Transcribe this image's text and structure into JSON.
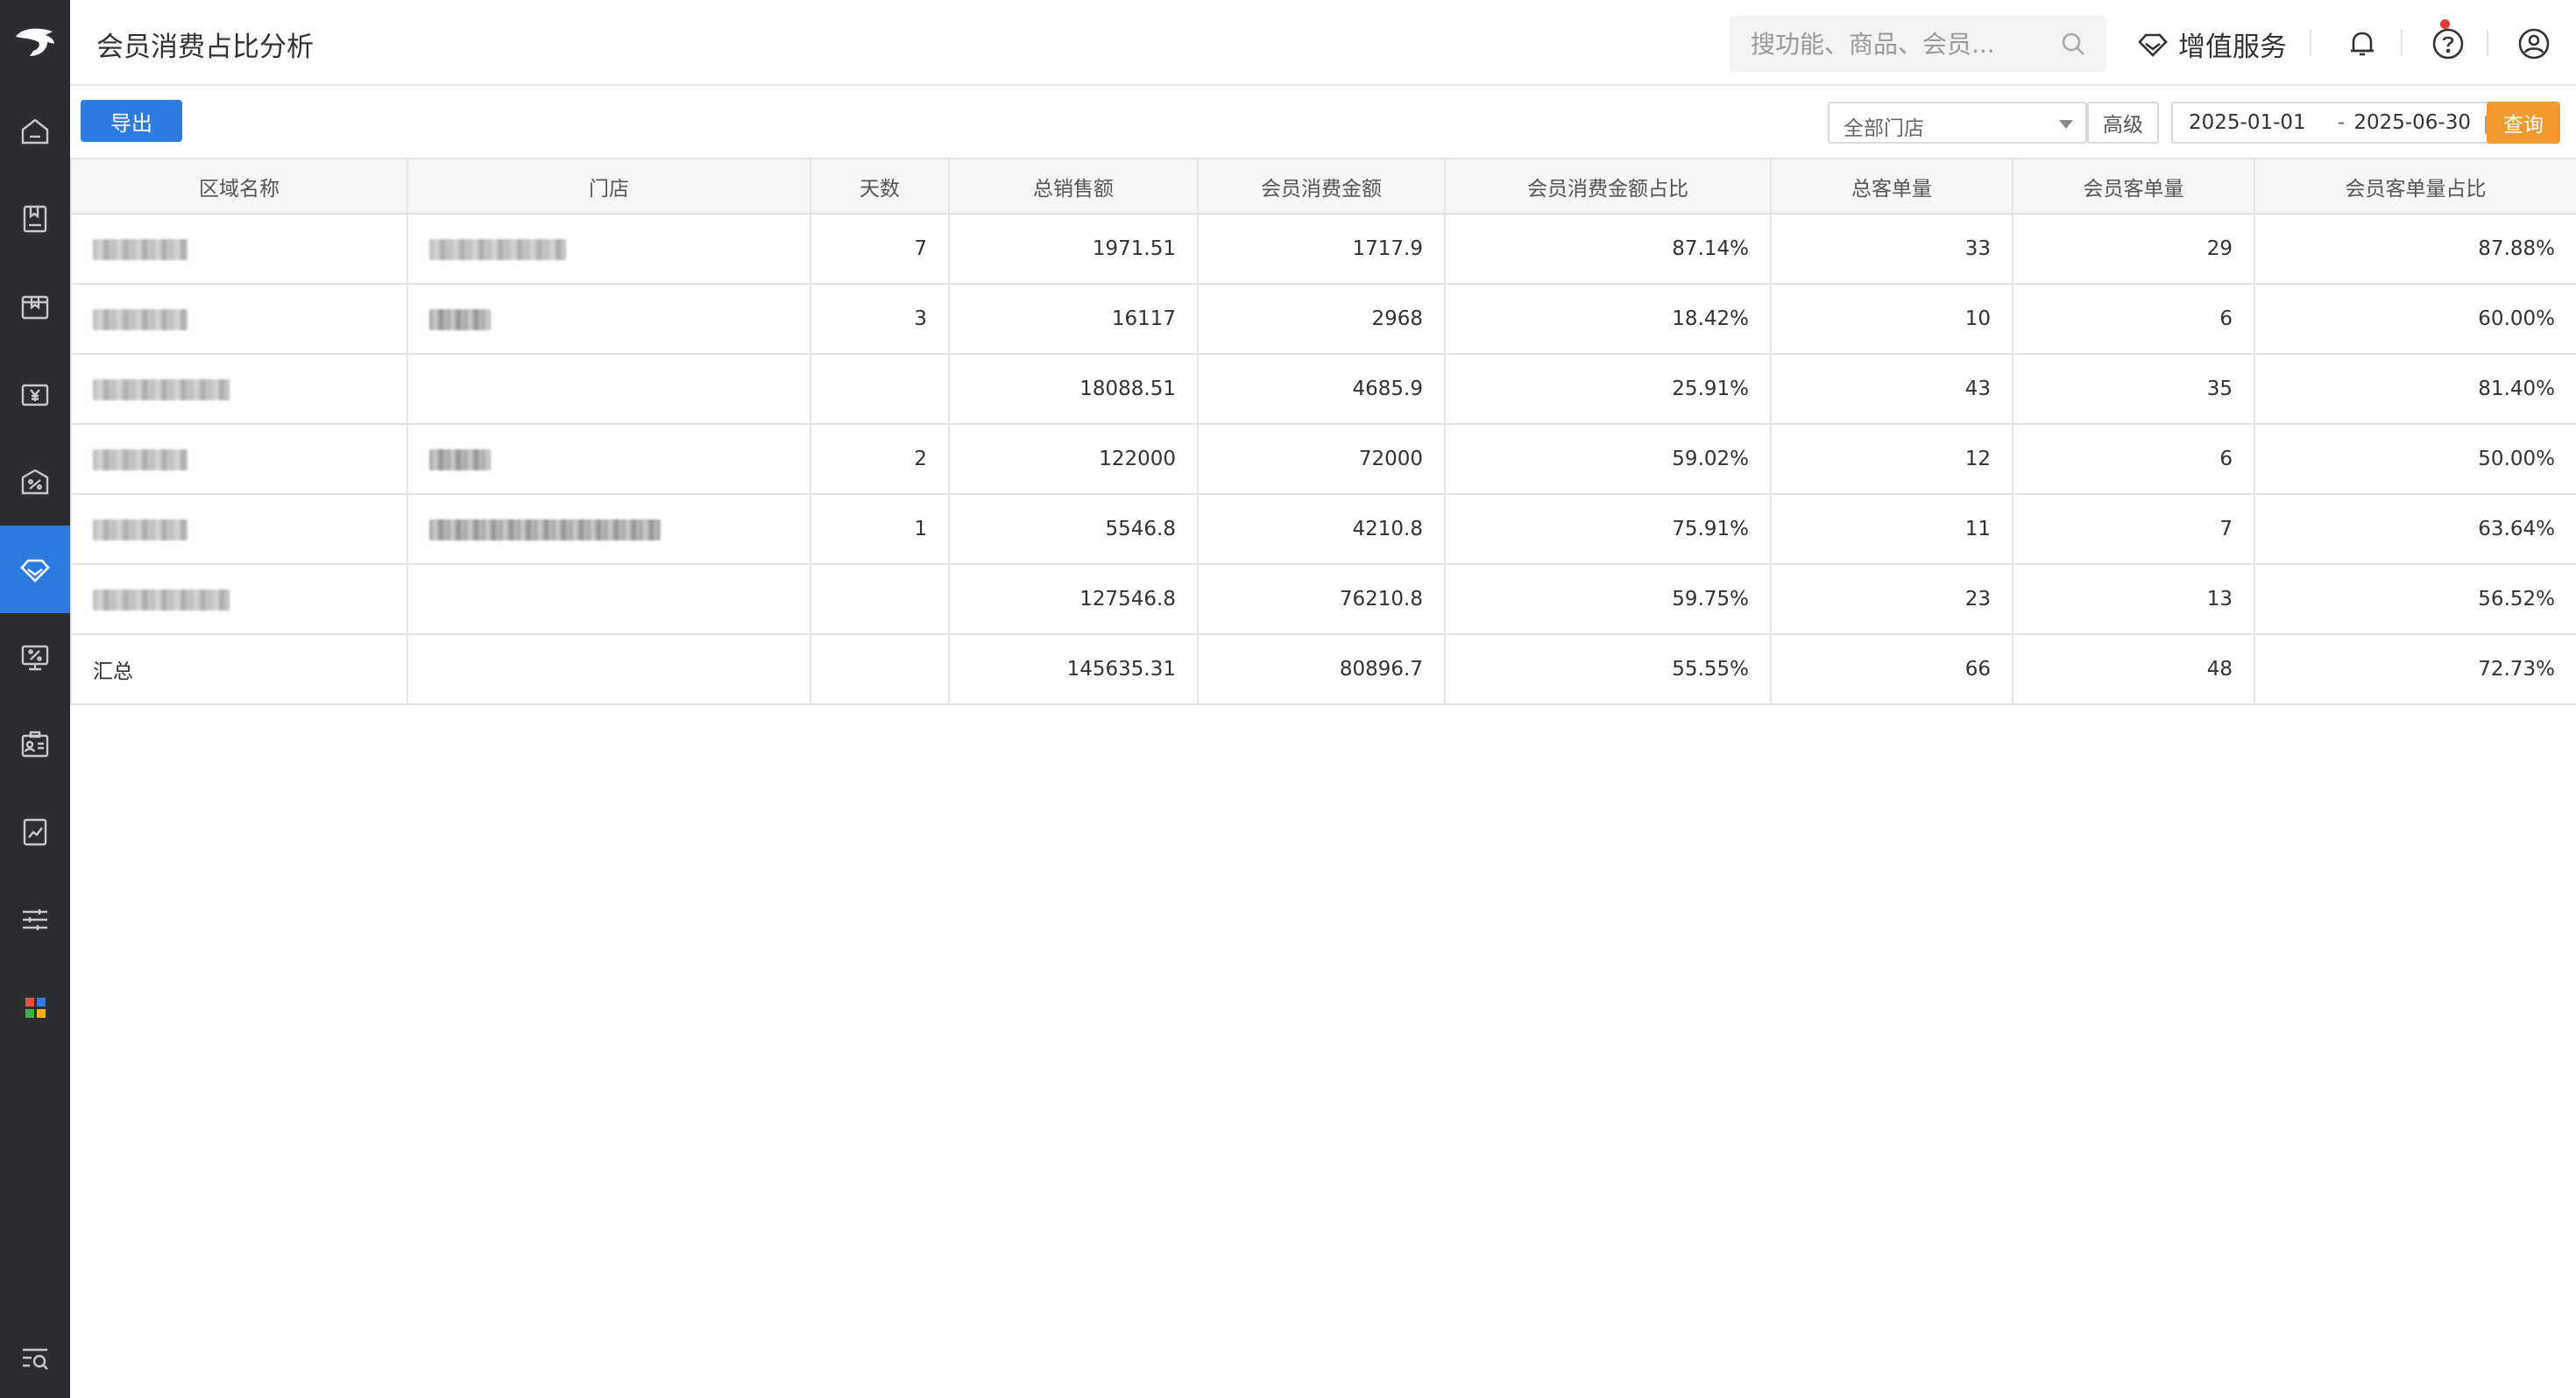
{
  "header": {
    "title": "会员消费占比分析",
    "search_placeholder": "搜功能、商品、会员...",
    "value_added_services": "增值服务"
  },
  "sidebar": {
    "icons": [
      "home-icon",
      "book-icon",
      "box-icon",
      "yen-icon",
      "ticket-icon",
      "diamond-icon",
      "monitor-percent-icon",
      "id-card-icon",
      "report-chart-icon",
      "sliders-icon",
      "apps-grid-icon",
      "menu-search-icon"
    ],
    "active_index": 5
  },
  "toolbar": {
    "export_label": "导出",
    "store_select": "全部门店",
    "advanced_label": "高级",
    "date_start": "2025-01-01",
    "date_separator": "-",
    "date_end": "2025-06-30",
    "query_label": "查询"
  },
  "table": {
    "columns": [
      "区域名称",
      "门店",
      "天数",
      "总销售额",
      "会员消费金额",
      "会员消费金额占比",
      "总客单量",
      "会员客单量",
      "会员客单量占比"
    ],
    "rows": [
      {
        "days": "7",
        "total_sales": "1971.51",
        "member_amount": "1717.9",
        "member_amount_ratio": "87.14%",
        "total_orders": "33",
        "member_orders": "29",
        "member_orders_ratio": "87.88%"
      },
      {
        "days": "3",
        "total_sales": "16117",
        "member_amount": "2968",
        "member_amount_ratio": "18.42%",
        "total_orders": "10",
        "member_orders": "6",
        "member_orders_ratio": "60.00%"
      },
      {
        "days": "",
        "total_sales": "18088.51",
        "member_amount": "4685.9",
        "member_amount_ratio": "25.91%",
        "total_orders": "43",
        "member_orders": "35",
        "member_orders_ratio": "81.40%"
      },
      {
        "days": "2",
        "total_sales": "122000",
        "member_amount": "72000",
        "member_amount_ratio": "59.02%",
        "total_orders": "12",
        "member_orders": "6",
        "member_orders_ratio": "50.00%"
      },
      {
        "days": "1",
        "total_sales": "5546.8",
        "member_amount": "4210.8",
        "member_amount_ratio": "75.91%",
        "total_orders": "11",
        "member_orders": "7",
        "member_orders_ratio": "63.64%"
      },
      {
        "days": "",
        "total_sales": "127546.8",
        "member_amount": "76210.8",
        "member_amount_ratio": "59.75%",
        "total_orders": "23",
        "member_orders": "13",
        "member_orders_ratio": "56.52%"
      }
    ],
    "summary": {
      "label": "汇总",
      "total_sales": "145635.31",
      "member_amount": "80896.7",
      "member_amount_ratio": "55.55%",
      "total_orders": "66",
      "member_orders": "48",
      "member_orders_ratio": "72.73%"
    }
  }
}
